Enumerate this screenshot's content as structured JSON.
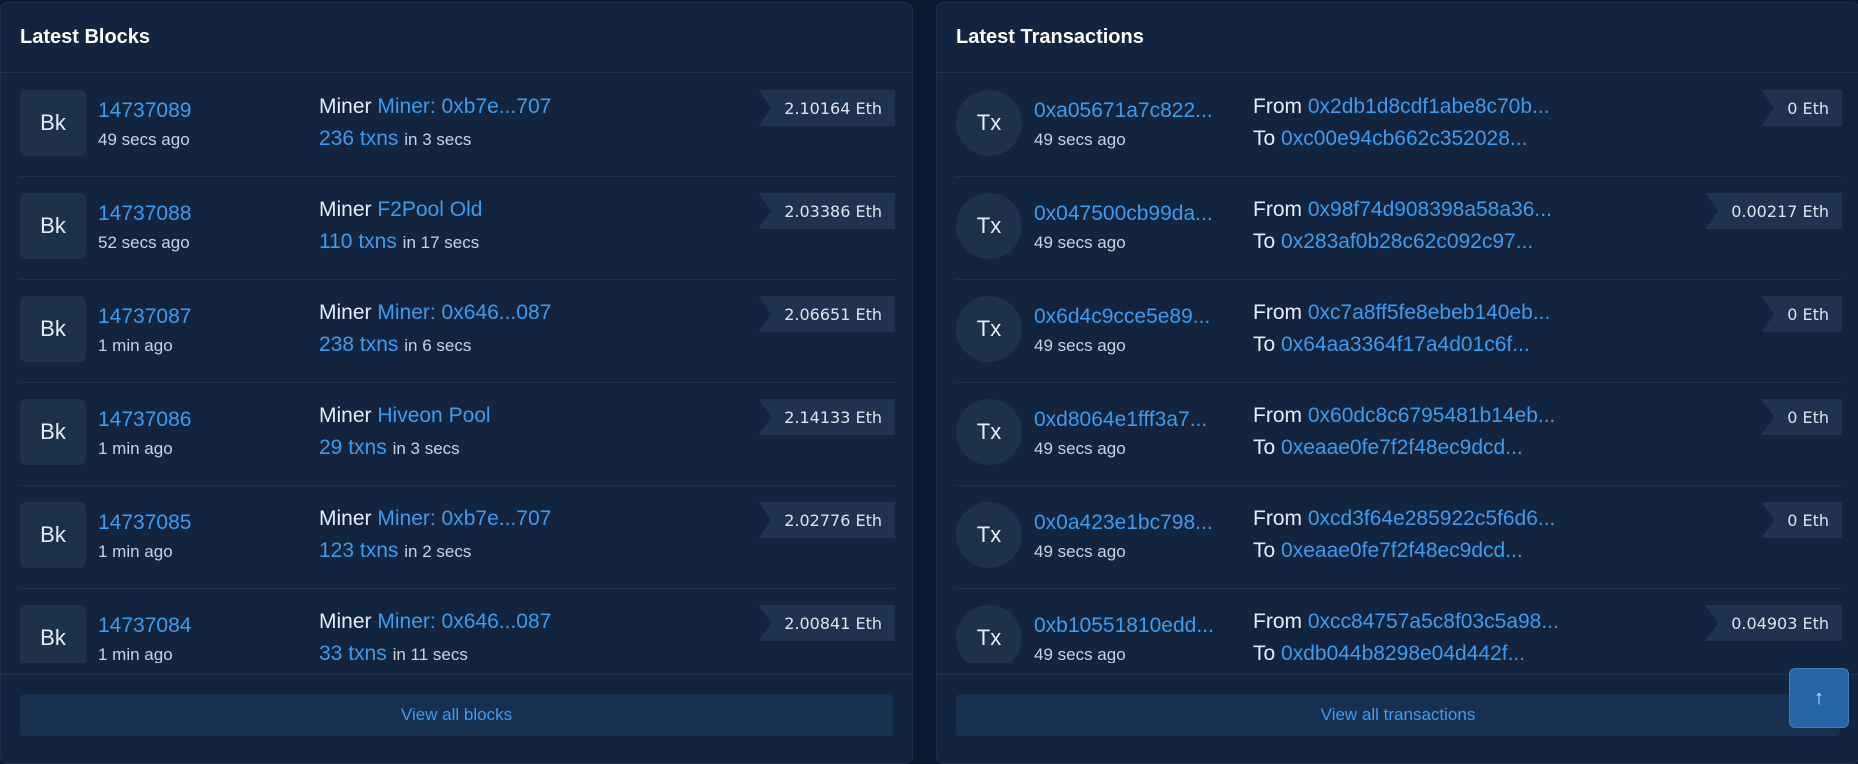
{
  "blocks": {
    "title": "Latest Blocks",
    "view_all": "View all blocks",
    "items": [
      {
        "avatar": "Bk",
        "number": "14737089",
        "time": "49 secs ago",
        "miner_label": "Miner",
        "miner": "Miner: 0xb7e...707",
        "txns": "236 txns",
        "duration": "in 3 secs",
        "reward": "2.10164 Eth"
      },
      {
        "avatar": "Bk",
        "number": "14737088",
        "time": "52 secs ago",
        "miner_label": "Miner",
        "miner": "F2Pool Old",
        "txns": "110 txns",
        "duration": "in 17 secs",
        "reward": "2.03386 Eth"
      },
      {
        "avatar": "Bk",
        "number": "14737087",
        "time": "1 min ago",
        "miner_label": "Miner",
        "miner": "Miner: 0x646...087",
        "txns": "238 txns",
        "duration": "in 6 secs",
        "reward": "2.06651 Eth"
      },
      {
        "avatar": "Bk",
        "number": "14737086",
        "time": "1 min ago",
        "miner_label": "Miner",
        "miner": "Hiveon Pool",
        "txns": "29 txns",
        "duration": "in 3 secs",
        "reward": "2.14133 Eth"
      },
      {
        "avatar": "Bk",
        "number": "14737085",
        "time": "1 min ago",
        "miner_label": "Miner",
        "miner": "Miner: 0xb7e...707",
        "txns": "123 txns",
        "duration": "in 2 secs",
        "reward": "2.02776 Eth"
      },
      {
        "avatar": "Bk",
        "number": "14737084",
        "time": "1 min ago",
        "miner_label": "Miner",
        "miner": "Miner: 0x646...087",
        "txns": "33 txns",
        "duration": "in 11 secs",
        "reward": "2.00841 Eth"
      }
    ]
  },
  "transactions": {
    "title": "Latest Transactions",
    "view_all": "View all transactions",
    "items": [
      {
        "avatar": "Tx",
        "hash": "0xa05671a7c822...",
        "time": "49 secs ago",
        "from_label": "From",
        "from": "0x2db1d8cdf1abe8c70b...",
        "to_label": "To",
        "to": "0xc00e94cb662c352028...",
        "value": "0 Eth"
      },
      {
        "avatar": "Tx",
        "hash": "0x047500cb99da...",
        "time": "49 secs ago",
        "from_label": "From",
        "from": "0x98f74d908398a58a36...",
        "to_label": "To",
        "to": "0x283af0b28c62c092c97...",
        "value": "0.00217 Eth"
      },
      {
        "avatar": "Tx",
        "hash": "0x6d4c9cce5e89...",
        "time": "49 secs ago",
        "from_label": "From",
        "from": "0xc7a8ff5fe8ebeb140eb...",
        "to_label": "To",
        "to": "0x64aa3364f17a4d01c6f...",
        "value": "0 Eth"
      },
      {
        "avatar": "Tx",
        "hash": "0xd8064e1fff3a7...",
        "time": "49 secs ago",
        "from_label": "From",
        "from": "0x60dc8c6795481b14eb...",
        "to_label": "To",
        "to": "0xeaae0fe7f2f48ec9dcd...",
        "value": "0 Eth"
      },
      {
        "avatar": "Tx",
        "hash": "0x0a423e1bc798...",
        "time": "49 secs ago",
        "from_label": "From",
        "from": "0xcd3f64e285922c5f6d6...",
        "to_label": "To",
        "to": "0xeaae0fe7f2f48ec9dcd...",
        "value": "0 Eth"
      },
      {
        "avatar": "Tx",
        "hash": "0xb10551810edd...",
        "time": "49 secs ago",
        "from_label": "From",
        "from": "0xcc84757a5c8f03c5a98...",
        "to_label": "To",
        "to": "0xdb044b8298e04d442f...",
        "value": "0.04903 Eth"
      }
    ]
  },
  "scroll_top_icon": "arrow-up-icon",
  "scroll_top_glyph": "↑",
  "colors": {
    "background": "#0b1a30",
    "card": "#12243e",
    "link": "#3d9cf0",
    "tag": "#1f3350",
    "scroll_button": "#2565a6"
  }
}
